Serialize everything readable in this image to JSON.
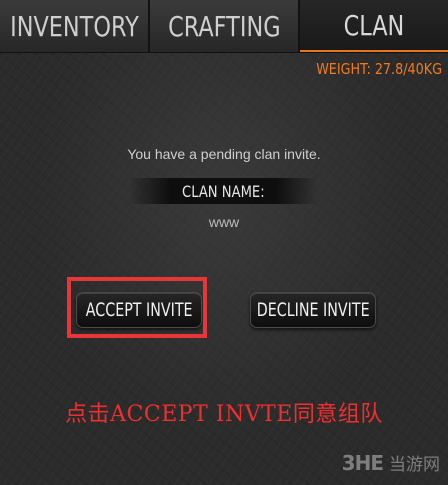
{
  "tabs": [
    {
      "label": "INVENTORY",
      "active": false
    },
    {
      "label": "CRAFTING",
      "active": false
    },
    {
      "label": "CLAN",
      "active": true
    }
  ],
  "weight": "WEIGHT: 27.8/40KG",
  "invite": {
    "message": "You have a pending clan invite.",
    "clan_name_label": "CLAN NAME:",
    "clan_name_value": "www"
  },
  "buttons": {
    "accept": "ACCEPT INVITE",
    "decline": "DECLINE INVITE"
  },
  "caption": "点击ACCEPT INVTE同意组队",
  "watermark": {
    "logo": "3HE",
    "text": "当游网"
  },
  "colors": {
    "accent": "#f07a22",
    "highlight": "#e8353a",
    "caption": "#ef2f2f"
  }
}
